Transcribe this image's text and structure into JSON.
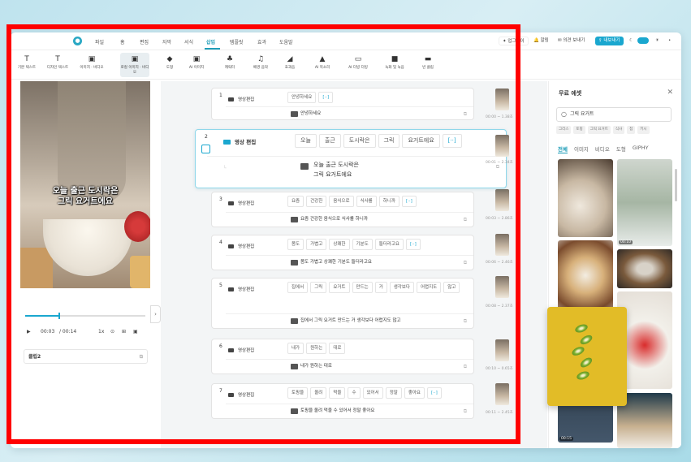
{
  "menubar": {
    "items": [
      "파일",
      "홈",
      "편집",
      "자막",
      "서식",
      "삽입",
      "템플릿",
      "효과",
      "도움말"
    ],
    "active_index": 5,
    "right": {
      "upgrade": "✦ 업그레이",
      "notice": "알림",
      "feedback": "의견 보내기",
      "export": "내보내기"
    }
  },
  "toolbar": {
    "tools": [
      {
        "icon": "T",
        "label": "기본 텍스트"
      },
      {
        "icon": "T",
        "label": "디자인 텍스트"
      },
      {
        "icon": "▣",
        "label": "이미지 · 비디오"
      },
      {
        "icon": "▣",
        "label": "로컬 이미지 · 비디오"
      },
      {
        "icon": "◆",
        "label": "도형"
      },
      {
        "icon": "▣",
        "label": "AI 이미지"
      },
      {
        "icon": "♣",
        "label": "캐릭터"
      },
      {
        "icon": "♫",
        "label": "배경 음악"
      },
      {
        "icon": "◢",
        "label": "효과음"
      },
      {
        "icon": "▲",
        "label": "AI 목소리"
      },
      {
        "icon": "▭",
        "label": "AI 더빙 더빙"
      },
      {
        "icon": "■",
        "label": "녹화 및 녹음"
      },
      {
        "icon": "▬",
        "label": "빈 클립"
      }
    ]
  },
  "preview": {
    "caption_line1": "오늘 출근 도시락은",
    "caption_line2": "그릭 요거트에요",
    "time_current": "00:03",
    "time_total": "/ 00:14",
    "speed": "1x",
    "progress_fraction": 0.28,
    "clip_label": "클립2"
  },
  "rows": [
    {
      "num": "1",
      "type": "영상편집",
      "words": [
        "안녕하세요"
      ],
      "sub": "안녕하세요",
      "time": "00:00 ~ 1.38초"
    },
    {
      "num": "2",
      "type": "영상 편집",
      "words": [
        "오늘",
        "출근",
        "도시락은",
        "그릭",
        "요거트에요"
      ],
      "sub1": "오늘 출근 도시락은",
      "sub2": "그릭 요거트에요",
      "time": "00:01 ~ 2.34초"
    },
    {
      "num": "3",
      "type": "영상편집",
      "words": [
        "요즘",
        "건강한",
        "음식으로",
        "식사를",
        "하니까"
      ],
      "sub": "요즘 건강한 음식으로 식사를 하니까",
      "time": "00:03 ~ 2.86초"
    },
    {
      "num": "4",
      "type": "영상편집",
      "words": [
        "몸도",
        "가볍고",
        "상쾌한",
        "기분도",
        "들더라고요"
      ],
      "sub": "몸도 가볍고 상쾌한 기분도 들더라고요",
      "time": "00:06 ~ 2.46초"
    },
    {
      "num": "5",
      "type": "영상편집",
      "words": [
        "집에서",
        "그릭",
        "요거트",
        "만드는",
        "거",
        "생각보다",
        "어렵지도",
        "않고"
      ],
      "sub": "집에서 그릭 요거트 만드는 거 생각보다 어렵지도 않고",
      "time": "00:08 ~ 2.37초"
    },
    {
      "num": "6",
      "type": "영상편집",
      "words": [
        "내가",
        "원하는",
        "대로"
      ],
      "sub": "내가 원하는 대로",
      "time": "00:10 ~ 0.65초"
    },
    {
      "num": "7",
      "type": "영상편집",
      "words": [
        "토핑을",
        "올려",
        "먹을",
        "수",
        "있어서",
        "정말",
        "좋아요"
      ],
      "sub": "토핑을 올려 먹을 수 있어서 정말 좋아요",
      "time": "00:11 ~ 2.45초"
    }
  ],
  "more_chip": "[··]",
  "panel": {
    "title": "무료 에셋",
    "search_value": "그릭 요거트",
    "tags": [
      "그리스",
      "토핑",
      "그릭 요거트",
      "식사",
      "접",
      "키시"
    ],
    "tabs": [
      "전체",
      "이미지",
      "비디오",
      "도형",
      "GIPHY"
    ],
    "durations": [
      "00:16",
      "00:10",
      "00:15"
    ]
  },
  "colors": {
    "accent": "#1aa7cf",
    "highlight": "#ff0000",
    "kiwi_bg": "#e2bc27"
  }
}
